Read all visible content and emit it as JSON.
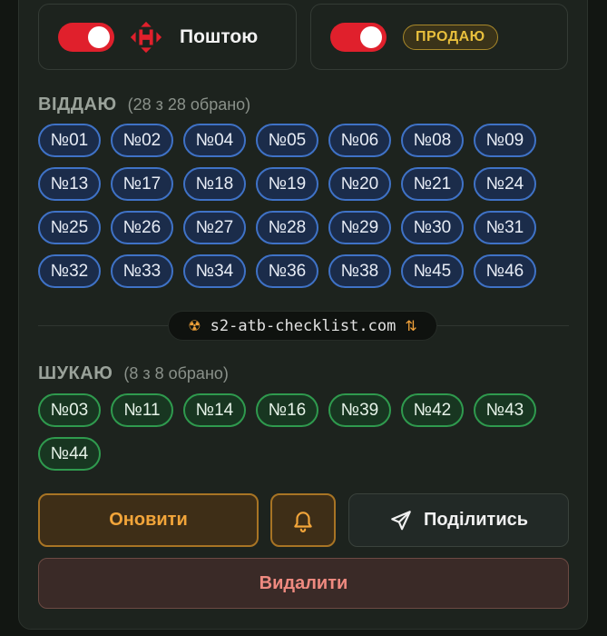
{
  "delivery": {
    "method_label": "Поштою",
    "method_logo_icon": "nova-poshta-logo-icon",
    "method_enabled": true,
    "sell_enabled": true,
    "sell_badge": "ПРОДАЮ"
  },
  "give": {
    "title": "ВІДДАЮ",
    "count_text": "(28 з 28 обрано)",
    "items": [
      "№01",
      "№02",
      "№04",
      "№05",
      "№06",
      "№08",
      "№09",
      "№13",
      "№17",
      "№18",
      "№19",
      "№20",
      "№21",
      "№24",
      "№25",
      "№26",
      "№27",
      "№28",
      "№29",
      "№30",
      "№31",
      "№32",
      "№33",
      "№34",
      "№36",
      "№38",
      "№45",
      "№46"
    ]
  },
  "site": {
    "url": "s2-atb-checklist.com",
    "left_icon": "radiation-icon",
    "right_icon": "swap-arrows-icon"
  },
  "want": {
    "title": "ШУКАЮ",
    "count_text": "(8 з 8 обрано)",
    "items": [
      "№03",
      "№11",
      "№14",
      "№16",
      "№39",
      "№42",
      "№43",
      "№44"
    ]
  },
  "actions": {
    "refresh_label": "Оновити",
    "bell_icon": "bell-icon",
    "share_label": "Поділитись",
    "share_icon": "send-icon",
    "delete_label": "Видалити"
  },
  "colors": {
    "toggle_on": "#e0202c",
    "give_chip_border": "#3f72c6",
    "want_chip_border": "#2f9a4e",
    "accent_orange": "#f2a53a",
    "delete_text": "#ef8a80"
  }
}
